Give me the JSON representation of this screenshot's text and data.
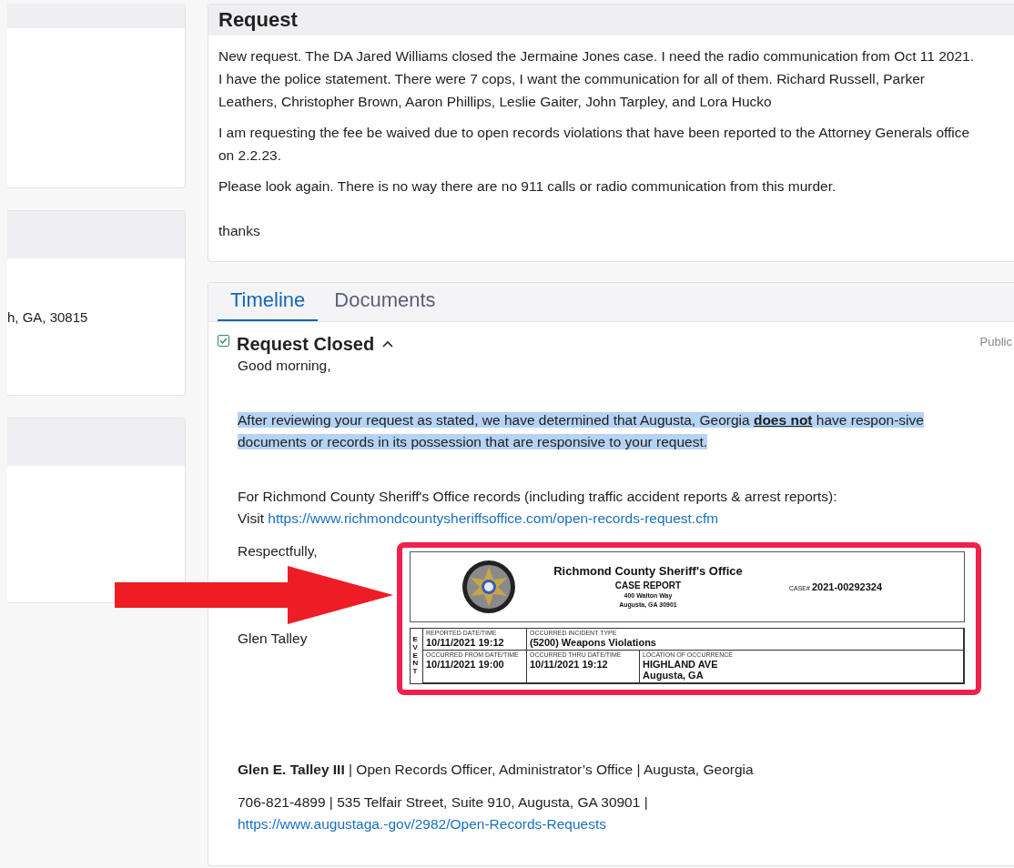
{
  "left_panel": {
    "address": "h, GA, 30815"
  },
  "request": {
    "title": "Request",
    "paragraphs": [
      "New request. The DA Jared Williams closed the Jermaine Jones case. I need the radio communication from Oct 11 2021. I have the police statement. There were 7 cops, I want the communication for all of them. Richard Russell, Parker Leathers, Christopher Brown, Aaron Phillips, Leslie Gaiter, John Tarpley, and Lora Hucko",
      "I am requesting the fee be waived due to open records violations that have been reported to the Attorney Generals office on 2.2.23.",
      "Please look again. There is no way there are no 911 calls or radio communication from this murder.",
      "thanks"
    ]
  },
  "tabs": [
    {
      "label": "Timeline",
      "selected": true
    },
    {
      "label": "Documents",
      "selected": false
    }
  ],
  "entry": {
    "title": "Request Closed",
    "checked": true,
    "expanded": true,
    "visibility": "Public",
    "greeting": "Good morning,",
    "highlighted_text": "After reviewing your request as stated, we have determined that Augusta, Georgia **does not** have respon-sive documents or records in its possession that are responsive to your request.",
    "highlighted": true,
    "sheriff_text": "For Richmond County Sheriff's Office records (including traffic accident reports & arrest reports):",
    "visit_label": "Visit",
    "sheriff_link": "https://www.richmondcountysheriffsoffice.com/open-records-request.cfm",
    "closing": "Respectfully,",
    "signer": "Glen Talley",
    "signature_name": "Glen E. Talley III",
    "signature_title": " | Open Records Officer, Administrator’s Office | Augusta, Georgia",
    "contact": " 706-821-4899 | 535 Telfair Street, Suite 910, Augusta, GA 30901 | ",
    "contact_link": "https://www.augustaga.-gov/2982/Open-Records-Requests"
  },
  "case_report": {
    "agency": "Richmond County Sheriff's Office",
    "doc_title": "CASE REPORT",
    "address1": "400 Walton Way",
    "address2": "Augusta, GA 30901",
    "case_label": "CASE#",
    "case_number": "2021-00292324",
    "section": "EVENT",
    "fields": [
      {
        "label": "REPORTED DATE/TIME",
        "value": "10/11/2021  19:12"
      },
      {
        "label": "OCCURRED INCIDENT TYPE",
        "value": "(5200) Weapons Violations"
      },
      {
        "label": "OCCURRED FROM DATE/TIME",
        "value": "10/11/2021  19:00"
      },
      {
        "label": "OCCURRED THRU DATE/TIME",
        "value": "10/11/2021   19:12"
      },
      {
        "label": "LOCATION OF OCCURRENCE",
        "value": "HIGHLAND AVE\nAugusta, GA"
      }
    ]
  }
}
